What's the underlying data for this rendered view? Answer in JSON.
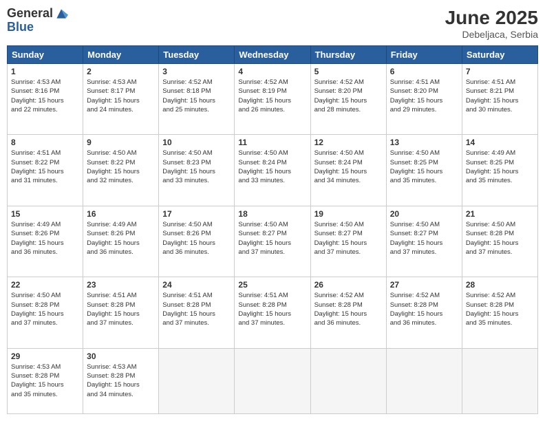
{
  "logo": {
    "general": "General",
    "blue": "Blue"
  },
  "title": {
    "month_year": "June 2025",
    "location": "Debeljaca, Serbia"
  },
  "headers": [
    "Sunday",
    "Monday",
    "Tuesday",
    "Wednesday",
    "Thursday",
    "Friday",
    "Saturday"
  ],
  "weeks": [
    [
      {
        "day": "1",
        "info": "Sunrise: 4:53 AM\nSunset: 8:16 PM\nDaylight: 15 hours\nand 22 minutes."
      },
      {
        "day": "2",
        "info": "Sunrise: 4:53 AM\nSunset: 8:17 PM\nDaylight: 15 hours\nand 24 minutes."
      },
      {
        "day": "3",
        "info": "Sunrise: 4:52 AM\nSunset: 8:18 PM\nDaylight: 15 hours\nand 25 minutes."
      },
      {
        "day": "4",
        "info": "Sunrise: 4:52 AM\nSunset: 8:19 PM\nDaylight: 15 hours\nand 26 minutes."
      },
      {
        "day": "5",
        "info": "Sunrise: 4:52 AM\nSunset: 8:20 PM\nDaylight: 15 hours\nand 28 minutes."
      },
      {
        "day": "6",
        "info": "Sunrise: 4:51 AM\nSunset: 8:20 PM\nDaylight: 15 hours\nand 29 minutes."
      },
      {
        "day": "7",
        "info": "Sunrise: 4:51 AM\nSunset: 8:21 PM\nDaylight: 15 hours\nand 30 minutes."
      }
    ],
    [
      {
        "day": "8",
        "info": "Sunrise: 4:51 AM\nSunset: 8:22 PM\nDaylight: 15 hours\nand 31 minutes."
      },
      {
        "day": "9",
        "info": "Sunrise: 4:50 AM\nSunset: 8:22 PM\nDaylight: 15 hours\nand 32 minutes."
      },
      {
        "day": "10",
        "info": "Sunrise: 4:50 AM\nSunset: 8:23 PM\nDaylight: 15 hours\nand 33 minutes."
      },
      {
        "day": "11",
        "info": "Sunrise: 4:50 AM\nSunset: 8:24 PM\nDaylight: 15 hours\nand 33 minutes."
      },
      {
        "day": "12",
        "info": "Sunrise: 4:50 AM\nSunset: 8:24 PM\nDaylight: 15 hours\nand 34 minutes."
      },
      {
        "day": "13",
        "info": "Sunrise: 4:50 AM\nSunset: 8:25 PM\nDaylight: 15 hours\nand 35 minutes."
      },
      {
        "day": "14",
        "info": "Sunrise: 4:49 AM\nSunset: 8:25 PM\nDaylight: 15 hours\nand 35 minutes."
      }
    ],
    [
      {
        "day": "15",
        "info": "Sunrise: 4:49 AM\nSunset: 8:26 PM\nDaylight: 15 hours\nand 36 minutes."
      },
      {
        "day": "16",
        "info": "Sunrise: 4:49 AM\nSunset: 8:26 PM\nDaylight: 15 hours\nand 36 minutes."
      },
      {
        "day": "17",
        "info": "Sunrise: 4:50 AM\nSunset: 8:26 PM\nDaylight: 15 hours\nand 36 minutes."
      },
      {
        "day": "18",
        "info": "Sunrise: 4:50 AM\nSunset: 8:27 PM\nDaylight: 15 hours\nand 37 minutes."
      },
      {
        "day": "19",
        "info": "Sunrise: 4:50 AM\nSunset: 8:27 PM\nDaylight: 15 hours\nand 37 minutes."
      },
      {
        "day": "20",
        "info": "Sunrise: 4:50 AM\nSunset: 8:27 PM\nDaylight: 15 hours\nand 37 minutes."
      },
      {
        "day": "21",
        "info": "Sunrise: 4:50 AM\nSunset: 8:28 PM\nDaylight: 15 hours\nand 37 minutes."
      }
    ],
    [
      {
        "day": "22",
        "info": "Sunrise: 4:50 AM\nSunset: 8:28 PM\nDaylight: 15 hours\nand 37 minutes."
      },
      {
        "day": "23",
        "info": "Sunrise: 4:51 AM\nSunset: 8:28 PM\nDaylight: 15 hours\nand 37 minutes."
      },
      {
        "day": "24",
        "info": "Sunrise: 4:51 AM\nSunset: 8:28 PM\nDaylight: 15 hours\nand 37 minutes."
      },
      {
        "day": "25",
        "info": "Sunrise: 4:51 AM\nSunset: 8:28 PM\nDaylight: 15 hours\nand 37 minutes."
      },
      {
        "day": "26",
        "info": "Sunrise: 4:52 AM\nSunset: 8:28 PM\nDaylight: 15 hours\nand 36 minutes."
      },
      {
        "day": "27",
        "info": "Sunrise: 4:52 AM\nSunset: 8:28 PM\nDaylight: 15 hours\nand 36 minutes."
      },
      {
        "day": "28",
        "info": "Sunrise: 4:52 AM\nSunset: 8:28 PM\nDaylight: 15 hours\nand 35 minutes."
      }
    ],
    [
      {
        "day": "29",
        "info": "Sunrise: 4:53 AM\nSunset: 8:28 PM\nDaylight: 15 hours\nand 35 minutes."
      },
      {
        "day": "30",
        "info": "Sunrise: 4:53 AM\nSunset: 8:28 PM\nDaylight: 15 hours\nand 34 minutes."
      },
      {
        "day": "",
        "info": ""
      },
      {
        "day": "",
        "info": ""
      },
      {
        "day": "",
        "info": ""
      },
      {
        "day": "",
        "info": ""
      },
      {
        "day": "",
        "info": ""
      }
    ]
  ]
}
